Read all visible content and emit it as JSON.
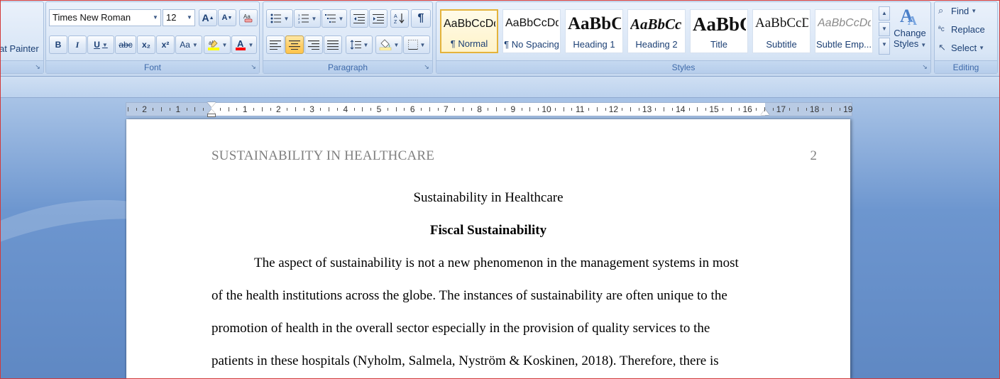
{
  "clipboard": {
    "format_painter_label": "at Painter"
  },
  "font": {
    "group_label": "Font",
    "font_name": "Times New Roman",
    "font_size": "12",
    "grow_font_label": "A",
    "shrink_font_label": "A",
    "bold_label": "B",
    "italic_label": "I",
    "underline_label": "U",
    "strikethrough_label": "abc",
    "subscript_label": "x₂",
    "superscript_label": "x²",
    "change_case_label": "Aa",
    "highlight_color": "#ffff00",
    "font_color": "#ff0000"
  },
  "paragraph": {
    "group_label": "Paragraph"
  },
  "styles": {
    "group_label": "Styles",
    "items": [
      {
        "sample": "AaBbCcDd",
        "name": "¶ Normal"
      },
      {
        "sample": "AaBbCcDd",
        "name": "¶ No Spacing"
      },
      {
        "sample": "AaBbC",
        "name": "Heading 1"
      },
      {
        "sample": "AaBbCc",
        "name": "Heading 2"
      },
      {
        "sample": "AaBbC",
        "name": "Title"
      },
      {
        "sample": "AaBbCcD",
        "name": "Subtitle"
      },
      {
        "sample": "AaBbCcDd",
        "name": "Subtle Emp..."
      }
    ],
    "change_styles_line1": "Change",
    "change_styles_line2": "Styles"
  },
  "editing": {
    "group_label": "Editing",
    "find_label": "Find",
    "replace_label": "Replace",
    "select_label": "Select"
  },
  "ruler": {
    "labels": [
      "2",
      "1",
      "1",
      "2",
      "3",
      "4",
      "5",
      "6",
      "7",
      "8",
      "9",
      "10",
      "11",
      "12",
      "13",
      "14",
      "15",
      "16",
      "17",
      "18",
      "19"
    ]
  },
  "document": {
    "running_head": "SUSTAINABILITY IN HEALTHCARE",
    "page_number": "2",
    "title": "Sustainability in Healthcare",
    "heading": "Fiscal Sustainability",
    "lines": [
      "The aspect of sustainability is not a new phenomenon in the management systems in most",
      "of the health institutions across the globe. The instances of sustainability are often unique to the",
      "promotion of health in the overall sector especially in the provision of quality services to the",
      "patients in these hospitals (Nyholm, Salmela, Nyström & Koskinen, 2018). Therefore, there is"
    ]
  },
  "colors": {
    "ribbon_text": "#15428b",
    "selected_style_border": "#e4b33b",
    "active_button": "#ffd16e"
  }
}
